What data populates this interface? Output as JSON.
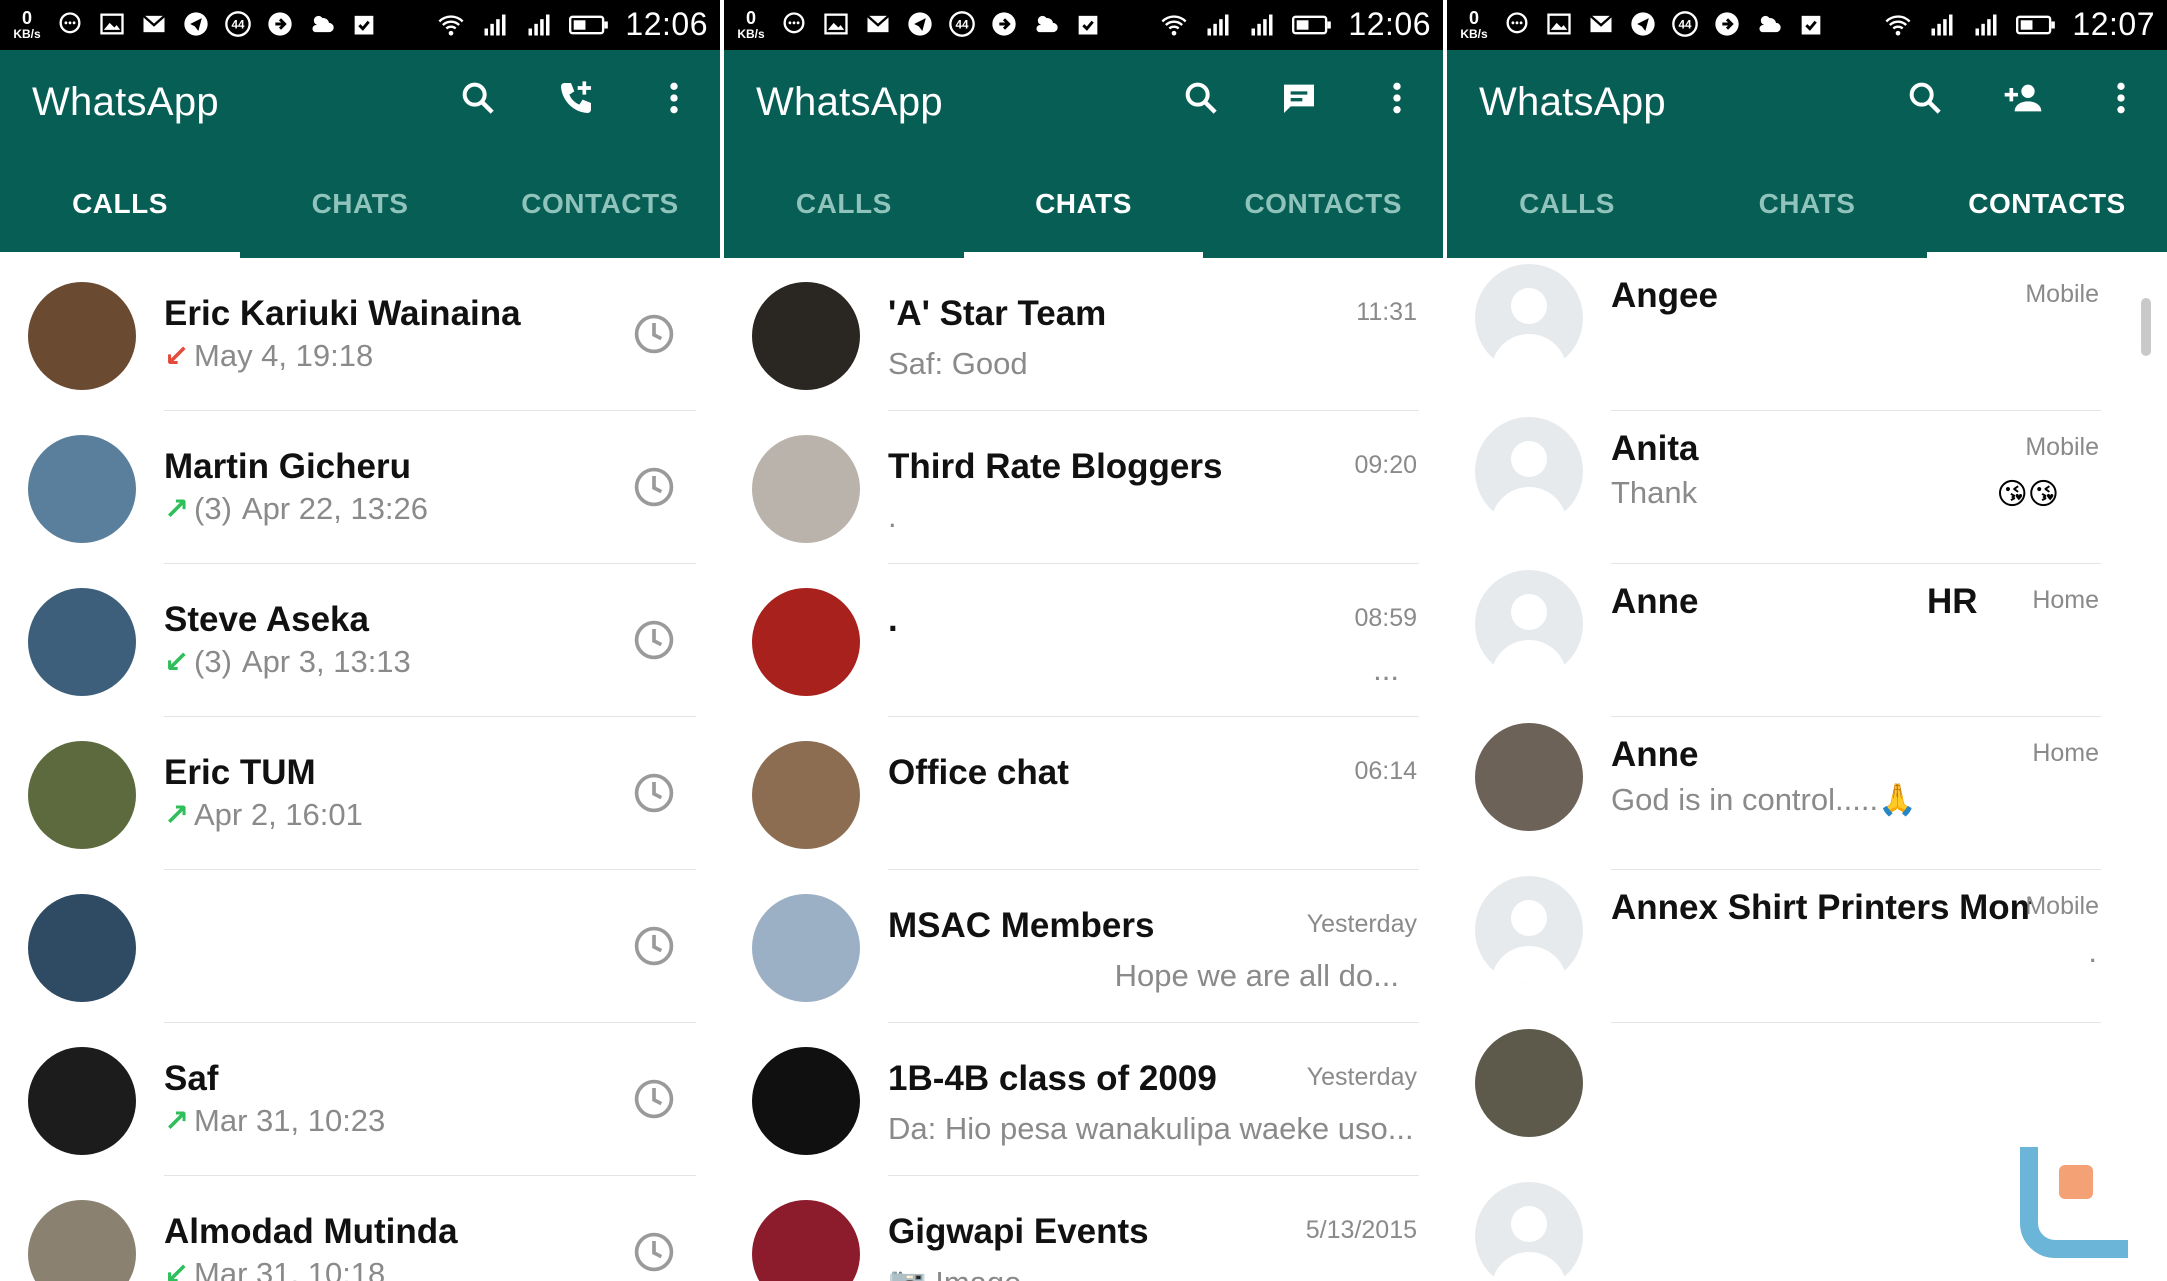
{
  "status_bar": {
    "kb_value": "0",
    "kb_unit": "KB/s",
    "notif_count": "44",
    "screens": [
      {
        "time": "12:06"
      },
      {
        "time": "12:06"
      },
      {
        "time": "12:07"
      }
    ]
  },
  "app": {
    "title": "WhatsApp",
    "tabs": [
      "CALLS",
      "CHATS",
      "CONTACTS"
    ],
    "accent_color": "#075e54"
  },
  "calls": [
    {
      "name": "Eric Kariuki Wainaina",
      "direction": "missed",
      "count": "",
      "datetime": "May 4, 19:18",
      "avatar_color": "#6b4a32"
    },
    {
      "name": "Martin Gicheru",
      "direction": "outgoing",
      "count": "(3)",
      "datetime": "Apr 22, 13:26",
      "avatar_color": "#5a7f9c"
    },
    {
      "name": "Steve Aseka",
      "direction": "incoming",
      "count": "(3)",
      "datetime": "Apr 3, 13:13",
      "avatar_color": "#3d5f7c"
    },
    {
      "name": "Eric TUM",
      "direction": "outgoing",
      "count": "",
      "datetime": "Apr 2, 16:01",
      "avatar_color": "#5d6a3e"
    },
    {
      "name": "",
      "direction": "",
      "count": "",
      "datetime": "",
      "avatar_color": "#2f4b63"
    },
    {
      "name": "Saf",
      "direction": "outgoing",
      "count": "",
      "datetime": "Mar 31, 10:23",
      "avatar_color": "#1c1c1c"
    },
    {
      "name": "Almodad Mutinda",
      "direction": "incoming",
      "count": "",
      "datetime": "Mar 31, 10:18",
      "avatar_color": "#8a8170"
    }
  ],
  "chats": [
    {
      "name": "'A' Star Team",
      "time": "11:31",
      "preview": "Saf: Good",
      "avatar_color": "#2a2622"
    },
    {
      "name": "Third Rate Bloggers",
      "time": "09:20",
      "preview": ".",
      "avatar_color": "#b9b3ab"
    },
    {
      "name": ".",
      "time": "08:59",
      "preview": "...",
      "avatar_color": "#a8211c"
    },
    {
      "name": "Office chat",
      "time": "06:14",
      "preview": "",
      "avatar_color": "#8c6d52"
    },
    {
      "name": "MSAC Members",
      "time": "Yesterday",
      "preview": "Hope we are all do...",
      "avatar_color": "#9bb0c4"
    },
    {
      "name": "1B-4B class of 2009",
      "time": "Yesterday",
      "preview": "Da: Hio pesa wanakulipa waeke uso...",
      "avatar_color": "#101010"
    },
    {
      "name": "Gigwapi Events",
      "time": "5/13/2015",
      "preview": "Image",
      "avatar_color": "#8c1c2c"
    }
  ],
  "contacts": [
    {
      "name": "Angee",
      "type": "Mobile",
      "status": "",
      "extra": "",
      "emoji": "",
      "photo": false
    },
    {
      "name": "Anita",
      "type": "Mobile",
      "status": "Thank",
      "extra": "",
      "emoji": "😘😘",
      "photo": false
    },
    {
      "name": "Anne",
      "type": "Home",
      "status": "",
      "extra": "HR",
      "emoji": "",
      "photo": false
    },
    {
      "name": "Anne",
      "type": "Home",
      "status": "God is in control.....🙏",
      "extra": "",
      "emoji": "",
      "photo": true,
      "avatar_color": "#6c6257"
    },
    {
      "name": "Annex Shirt Printers Mom...",
      "type": "Mobile",
      "status": ".",
      "extra": "",
      "emoji": "",
      "photo": false
    },
    {
      "name": "",
      "type": "",
      "status": "",
      "extra": "",
      "emoji": "",
      "photo": true,
      "avatar_color": "#5d5a4c"
    },
    {
      "name": "",
      "type": "",
      "status": "",
      "extra": "",
      "emoji": "",
      "photo": false
    }
  ]
}
